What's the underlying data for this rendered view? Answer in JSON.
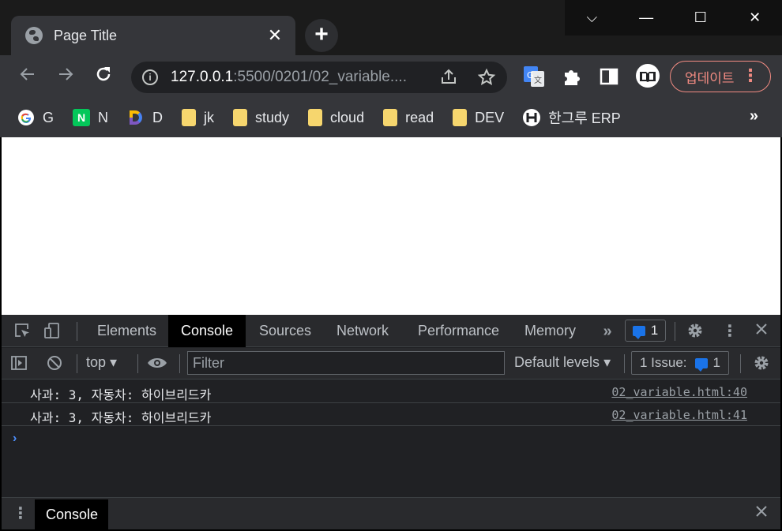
{
  "browser": {
    "tab_title": "Page Title",
    "tab_close": "✕",
    "new_tab": "+",
    "window_controls": [
      "⌵",
      "—",
      "☐",
      "✕"
    ],
    "url_host": "127.0.0.1",
    "url_path": ":5500/0201/02_variable....",
    "update_label": "업데이트"
  },
  "bookmarks": [
    {
      "label": "G",
      "icon": "google-icon"
    },
    {
      "label": "N",
      "icon": "naver-icon"
    },
    {
      "label": "D",
      "icon": "d-icon"
    },
    {
      "label": "jk",
      "icon": "folder-icon"
    },
    {
      "label": "study",
      "icon": "folder-icon"
    },
    {
      "label": "cloud",
      "icon": "folder-icon"
    },
    {
      "label": "read",
      "icon": "folder-icon"
    },
    {
      "label": "DEV",
      "icon": "folder-icon"
    },
    {
      "label": "한그루 ERP",
      "icon": "erp-icon"
    }
  ],
  "bookmarks_more": "»",
  "devtools": {
    "tabs": [
      "Elements",
      "Console",
      "Sources",
      "Network",
      "Performance",
      "Memory"
    ],
    "more_tabs": "»",
    "issues_badge": "1",
    "context": "top",
    "filter_placeholder": "Filter",
    "levels": "Default levels",
    "issues_label": "1 Issue:",
    "issues_count": "1",
    "logs": [
      {
        "message": "사과: 3, 자동차: 하이브리드카",
        "source": "02_variable.html:40"
      },
      {
        "message": "사과: 3, 자동차: 하이브리드카",
        "source": "02_variable.html:41"
      }
    ],
    "prompt": "›",
    "drawer_tab": "Console"
  },
  "colors": {
    "accent": "#1a73e8",
    "update_border": "#f28b82",
    "folder": "#f6d66e"
  }
}
